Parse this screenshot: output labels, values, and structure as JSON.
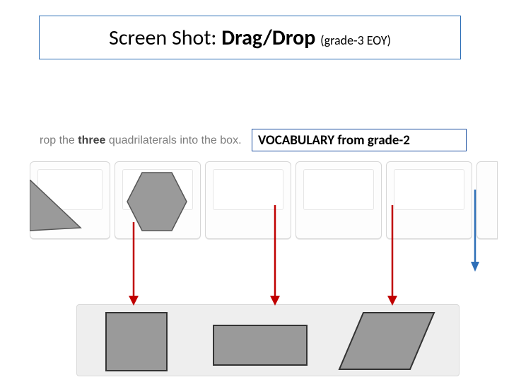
{
  "title": {
    "prefix": "Screen Shot: ",
    "main": "Drag/Drop ",
    "paren": "(grade-3 EOY)"
  },
  "prompt": {
    "pre": "rop the ",
    "bold": "three",
    "post": " quadrilaterals into the box."
  },
  "vocab": {
    "label": "VOCABULARY from grade-2"
  },
  "colors": {
    "shape_fill": "#9a9a9a",
    "shape_stroke": "#555555",
    "arrow_red": "#c00000",
    "arrow_blue": "#2e6fb7",
    "title_border": "#2e6fb7"
  },
  "shapes": {
    "source": [
      {
        "name": "triangle"
      },
      {
        "name": "hexagon"
      },
      {
        "name": "empty"
      },
      {
        "name": "empty"
      },
      {
        "name": "empty"
      }
    ],
    "dropped": [
      {
        "name": "square"
      },
      {
        "name": "rectangle"
      },
      {
        "name": "parallelogram"
      }
    ]
  }
}
